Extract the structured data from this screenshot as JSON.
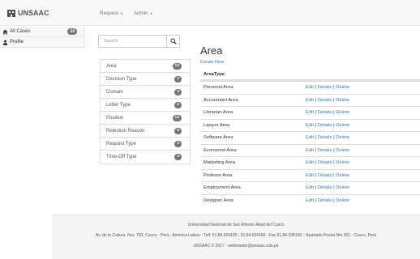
{
  "navbar": {
    "brand": "UNSAAC",
    "menu": [
      {
        "label": "Request"
      },
      {
        "label": "Admin"
      }
    ]
  },
  "leftnav": [
    {
      "label": "All Cases",
      "count": "14",
      "icon": "home-icon"
    },
    {
      "label": "Profile",
      "icon": "user-icon"
    }
  ],
  "search": {
    "placeholder": "Search"
  },
  "categories": [
    {
      "label": "Area",
      "count": "10"
    },
    {
      "label": "Decision Type",
      "count": "2"
    },
    {
      "label": "Domain",
      "count": "3"
    },
    {
      "label": "Letter Type",
      "count": "2"
    },
    {
      "label": "Position",
      "count": "10"
    },
    {
      "label": "Rejection Reason",
      "count": "6"
    },
    {
      "label": "Request Type",
      "count": "2"
    },
    {
      "label": "Time-Off Type",
      "count": "4"
    }
  ],
  "main": {
    "title": "Area",
    "create_new": "Create New",
    "column_header": "AreaType",
    "actions": {
      "edit": "Edit",
      "details": "Details",
      "delete": "Delete",
      "sep": "|"
    },
    "rows": [
      "Personal Area",
      "Accountant Area",
      "Librarian Area",
      "Lawyer Area",
      "Software Area",
      "Economist Area",
      "Marketing Area",
      "Profesor Area",
      "Employment Area",
      "Designer Area"
    ]
  },
  "footer": {
    "line1": "Universidad Nacional de San Antonio Abad del Cusco",
    "line2": "Av. de la Cultura, Nro. 733, Cusco - Perú - América Latina :: Telf: 51.84.604100 - 51.84.604160 - Fax.51.84.238156 :: Apartado Postal Nro 921 - Cusco, Perú",
    "line3": "UNSAAC © 2017 - webmaster@unsaac.edu.pe"
  }
}
